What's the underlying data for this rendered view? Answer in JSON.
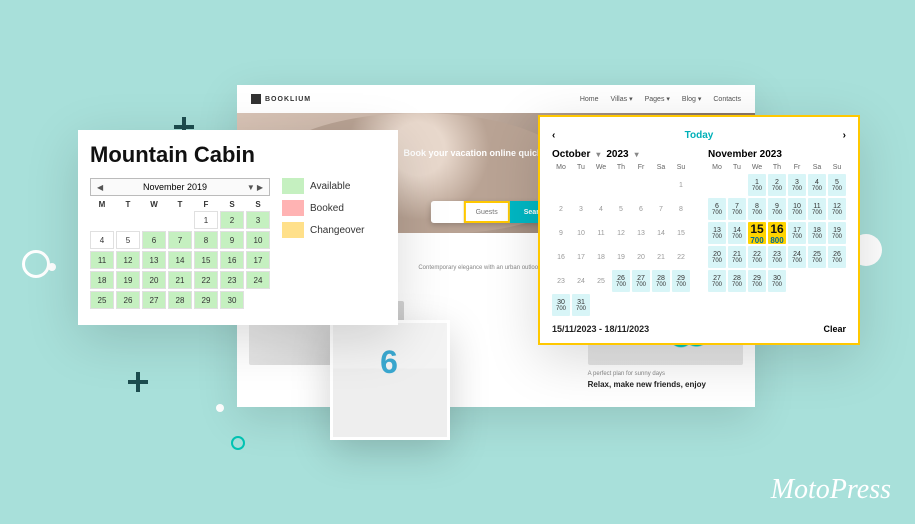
{
  "brand": "MotoPress",
  "decor": {},
  "site": {
    "brand": "BOOKLIUM",
    "menu": [
      "Home",
      "Villas ▾",
      "Pages ▾",
      "Blog ▾",
      "Contacts"
    ],
    "hero_text": "Book your vacation online quickly and safe",
    "search": {
      "guests_label": "Guests",
      "button": "Search"
    }
  },
  "caption_small": "Contemporary elegance with an urban outlook",
  "caption_tag": "A perfect plan for sunny days",
  "caption_headline": "Relax, make new friends, enjoy",
  "left": {
    "title": "Mountain Cabin",
    "month": "November 2019",
    "dow": [
      "M",
      "T",
      "W",
      "T",
      "F",
      "S",
      "S"
    ],
    "legend": [
      {
        "label": "Available",
        "color": "#c5f0c0"
      },
      {
        "label": "Booked",
        "color": "#ffb3b3"
      },
      {
        "label": "Changeover",
        "color": "#ffe08a"
      }
    ],
    "days": [
      {
        "n": "",
        "c": "empty"
      },
      {
        "n": "",
        "c": "empty"
      },
      {
        "n": "",
        "c": "empty"
      },
      {
        "n": "",
        "c": "empty"
      },
      {
        "n": "1",
        "c": ""
      },
      {
        "n": "2",
        "c": "av"
      },
      {
        "n": "3",
        "c": "av"
      },
      {
        "n": "4",
        "c": ""
      },
      {
        "n": "5",
        "c": ""
      },
      {
        "n": "6",
        "c": "av"
      },
      {
        "n": "7",
        "c": "av"
      },
      {
        "n": "8",
        "c": "av"
      },
      {
        "n": "9",
        "c": "av"
      },
      {
        "n": "10",
        "c": "av"
      },
      {
        "n": "11",
        "c": "av"
      },
      {
        "n": "12",
        "c": "av"
      },
      {
        "n": "13",
        "c": "av"
      },
      {
        "n": "14",
        "c": "av"
      },
      {
        "n": "15",
        "c": "av"
      },
      {
        "n": "16",
        "c": "av"
      },
      {
        "n": "17",
        "c": "av"
      },
      {
        "n": "18",
        "c": "av"
      },
      {
        "n": "19",
        "c": "av"
      },
      {
        "n": "20",
        "c": "av"
      },
      {
        "n": "21",
        "c": "av"
      },
      {
        "n": "22",
        "c": "av"
      },
      {
        "n": "23",
        "c": "av"
      },
      {
        "n": "24",
        "c": "av"
      },
      {
        "n": "25",
        "c": "av"
      },
      {
        "n": "26",
        "c": "av"
      },
      {
        "n": "27",
        "c": "av"
      },
      {
        "n": "28",
        "c": "av"
      },
      {
        "n": "29",
        "c": "av"
      },
      {
        "n": "30",
        "c": "av"
      },
      {
        "n": "",
        "c": "empty"
      }
    ]
  },
  "right": {
    "today": "Today",
    "range": "15/11/2023 - 18/11/2023",
    "clear": "Clear",
    "dow": [
      "Mo",
      "Tu",
      "We",
      "Th",
      "Fr",
      "Sa",
      "Su"
    ],
    "months": [
      {
        "name": "October",
        "year": "2023",
        "days": [
          {
            "t": "e"
          },
          {
            "t": "e"
          },
          {
            "t": "e"
          },
          {
            "t": "e"
          },
          {
            "t": "e"
          },
          {
            "t": "e"
          },
          {
            "n": "1",
            "t": "d"
          },
          {
            "n": "2",
            "t": "d"
          },
          {
            "n": "3",
            "t": "d"
          },
          {
            "n": "4",
            "t": "d"
          },
          {
            "n": "5",
            "t": "d"
          },
          {
            "n": "6",
            "t": "d"
          },
          {
            "n": "7",
            "t": "d"
          },
          {
            "n": "8",
            "t": "d"
          },
          {
            "n": "9",
            "t": "d"
          },
          {
            "n": "10",
            "t": "d"
          },
          {
            "n": "11",
            "t": "d"
          },
          {
            "n": "12",
            "t": "d"
          },
          {
            "n": "13",
            "t": "d"
          },
          {
            "n": "14",
            "t": "d"
          },
          {
            "n": "15",
            "t": "d"
          },
          {
            "n": "16",
            "t": "d"
          },
          {
            "n": "17",
            "t": "d"
          },
          {
            "n": "18",
            "t": "d"
          },
          {
            "n": "19",
            "t": "d"
          },
          {
            "n": "20",
            "t": "d"
          },
          {
            "n": "21",
            "t": "d"
          },
          {
            "n": "22",
            "t": "d"
          },
          {
            "n": "23",
            "t": "d"
          },
          {
            "n": "24",
            "t": "d"
          },
          {
            "n": "25",
            "t": "d"
          },
          {
            "n": "26",
            "t": "p",
            "p": "700"
          },
          {
            "n": "27",
            "t": "p",
            "p": "700"
          },
          {
            "n": "28",
            "t": "p",
            "p": "700"
          },
          {
            "n": "29",
            "t": "p",
            "p": "700"
          },
          {
            "n": "30",
            "t": "p",
            "p": "700"
          },
          {
            "n": "31",
            "t": "p",
            "p": "700"
          },
          {
            "t": "e"
          },
          {
            "t": "e"
          },
          {
            "t": "e"
          },
          {
            "t": "e"
          },
          {
            "t": "e"
          }
        ]
      },
      {
        "name": "November 2023",
        "year": "",
        "days": [
          {
            "t": "e"
          },
          {
            "t": "e"
          },
          {
            "n": "1",
            "t": "p",
            "p": "700"
          },
          {
            "n": "2",
            "t": "p",
            "p": "700"
          },
          {
            "n": "3",
            "t": "p",
            "p": "700"
          },
          {
            "n": "4",
            "t": "p",
            "p": "700"
          },
          {
            "n": "5",
            "t": "p",
            "p": "700"
          },
          {
            "n": "6",
            "t": "p",
            "p": "700"
          },
          {
            "n": "7",
            "t": "p",
            "p": "700"
          },
          {
            "n": "8",
            "t": "p",
            "p": "700"
          },
          {
            "n": "9",
            "t": "p",
            "p": "700"
          },
          {
            "n": "10",
            "t": "p",
            "p": "700"
          },
          {
            "n": "11",
            "t": "p",
            "p": "700"
          },
          {
            "n": "12",
            "t": "p",
            "p": "700"
          },
          {
            "n": "13",
            "t": "p",
            "p": "700"
          },
          {
            "n": "14",
            "t": "p",
            "p": "700"
          },
          {
            "n": "15",
            "t": "s",
            "p": "700"
          },
          {
            "n": "16",
            "t": "s",
            "p": "800"
          },
          {
            "n": "17",
            "t": "p",
            "p": "700"
          },
          {
            "n": "18",
            "t": "p",
            "p": "700"
          },
          {
            "n": "19",
            "t": "p",
            "p": "700"
          },
          {
            "n": "20",
            "t": "p",
            "p": "700"
          },
          {
            "n": "21",
            "t": "p",
            "p": "700"
          },
          {
            "n": "22",
            "t": "p",
            "p": "700"
          },
          {
            "n": "23",
            "t": "p",
            "p": "700"
          },
          {
            "n": "24",
            "t": "p",
            "p": "700"
          },
          {
            "n": "25",
            "t": "p",
            "p": "700"
          },
          {
            "n": "26",
            "t": "p",
            "p": "700"
          },
          {
            "n": "27",
            "t": "p",
            "p": "700"
          },
          {
            "n": "28",
            "t": "p",
            "p": "700"
          },
          {
            "n": "29",
            "t": "p",
            "p": "700"
          },
          {
            "n": "30",
            "t": "p",
            "p": "700"
          },
          {
            "t": "e"
          },
          {
            "t": "e"
          },
          {
            "t": "e"
          }
        ]
      }
    ]
  }
}
